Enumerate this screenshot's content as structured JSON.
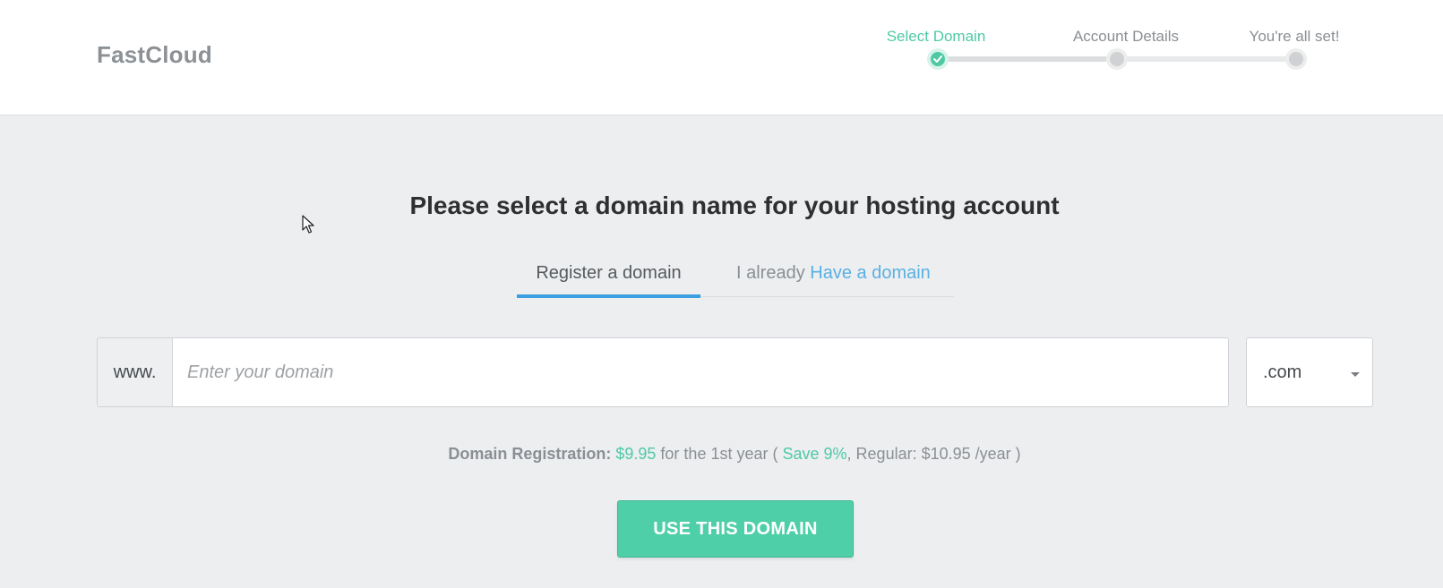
{
  "header": {
    "logo": "FastCloud",
    "steps": [
      {
        "label": "Select Domain",
        "state": "complete"
      },
      {
        "label": "Account Details",
        "state": "pending"
      },
      {
        "label": "You're all set!",
        "state": "pending"
      }
    ]
  },
  "main": {
    "title": "Please select a domain name for your hosting account",
    "tabs": {
      "register": "Register a domain",
      "have_prefix": "I already",
      "have_link": "Have a domain"
    },
    "domain": {
      "prefix": "www.",
      "placeholder": "Enter your domain",
      "value": "",
      "tld": ".com"
    },
    "pricing": {
      "label": "Domain Registration:",
      "price": "$9.95",
      "period": "for the 1st year (",
      "save": "Save 9%",
      "regular": ", Regular: $10.95 /year )"
    },
    "cta": "USE THIS DOMAIN"
  },
  "colors": {
    "accent_green": "#4fc9a4",
    "link_blue": "#5ab0e3",
    "tab_underline": "#3b9ee0",
    "page_bg": "#edeef0"
  },
  "icons": {
    "step_complete": "check-icon",
    "select_caret": "caret-down-icon",
    "cursor": "mouse-pointer-icon"
  }
}
